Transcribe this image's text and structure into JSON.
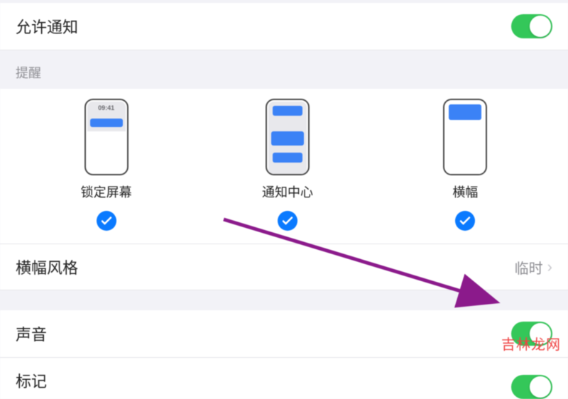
{
  "allow_notifications": {
    "label": "允许通知",
    "enabled": true
  },
  "alerts": {
    "section_title": "提醒",
    "lock_screen": {
      "label": "锁定屏幕",
      "time": "09:41",
      "checked": true
    },
    "notification_center": {
      "label": "通知中心",
      "checked": true
    },
    "banners": {
      "label": "横幅",
      "checked": true
    }
  },
  "banner_style": {
    "label": "横幅风格",
    "value": "临时"
  },
  "sounds": {
    "label": "声音",
    "enabled": true
  },
  "badges": {
    "label": "标记",
    "enabled": true
  },
  "annotation": {
    "arrow_color": "#8b1a8b"
  },
  "watermark": "吉林龙网"
}
